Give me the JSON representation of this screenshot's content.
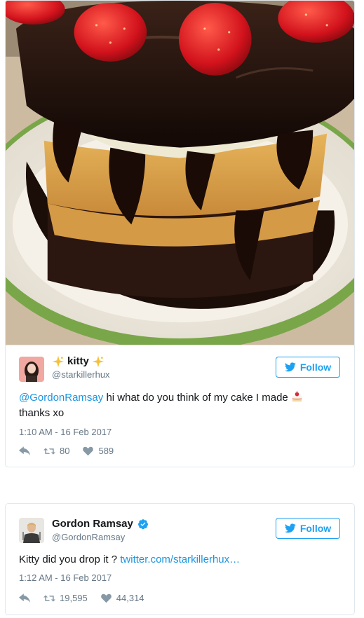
{
  "photo": {
    "subject": "layered cake with chocolate ganache and strawberries"
  },
  "tweets": [
    {
      "display_name": "kitty",
      "screen_name": "@starkillerhux",
      "follow_label": "Follow",
      "mention": "@GordonRamsay",
      "text": " hi what do you think of my cake I made",
      "text_line2": "thanks xo",
      "timestamp": "1:10 AM - 16 Feb 2017",
      "retweets": "80",
      "likes": "589"
    },
    {
      "display_name": "Gordon Ramsay",
      "screen_name": "@GordonRamsay",
      "follow_label": "Follow",
      "text": "Kitty did you drop it ? ",
      "link": "twitter.com/starkillerhux…",
      "timestamp": "1:12 AM - 16 Feb 2017",
      "retweets": "19,595",
      "likes": "44,314"
    }
  ],
  "colors": {
    "twitter_blue": "#1da1f2",
    "link_blue": "#1b95e0",
    "muted_gray": "#657786",
    "border": "#e1e8ed"
  },
  "icons": [
    "twitter-bird-icon",
    "reply-icon",
    "retweet-icon",
    "heart-icon",
    "sparkle-icon",
    "verified-icon",
    "cake-emoji-icon"
  ]
}
